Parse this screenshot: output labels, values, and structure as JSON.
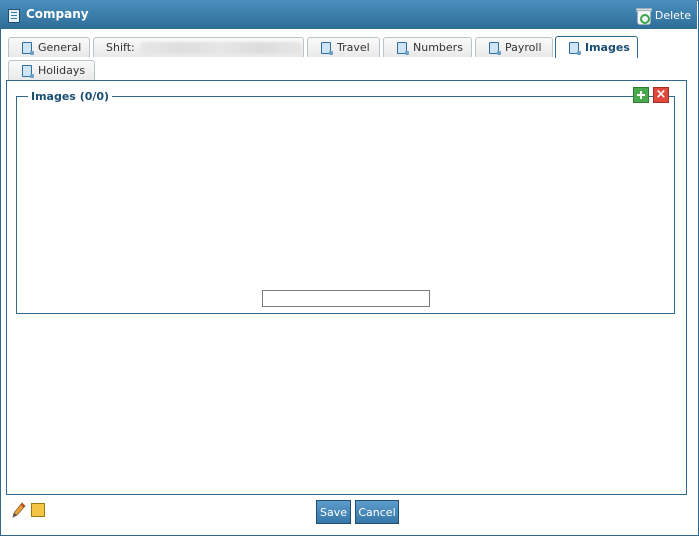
{
  "window": {
    "title": "Company",
    "delete_label": "Delete"
  },
  "tabs": [
    {
      "label": "General",
      "active": false
    },
    {
      "label": "Shift:",
      "active": false
    },
    {
      "label": "Travel",
      "active": false
    },
    {
      "label": "Numbers",
      "active": false
    },
    {
      "label": "Payroll",
      "active": false
    },
    {
      "label": "Images",
      "active": true
    },
    {
      "label": "Holidays",
      "active": false
    }
  ],
  "images_panel": {
    "legend": "Images (0/0)",
    "input_value": ""
  },
  "footer": {
    "save_label": "Save",
    "cancel_label": "Cancel"
  },
  "colors": {
    "accent": "#2f6a8e",
    "titlebar": "#3a7cab"
  }
}
